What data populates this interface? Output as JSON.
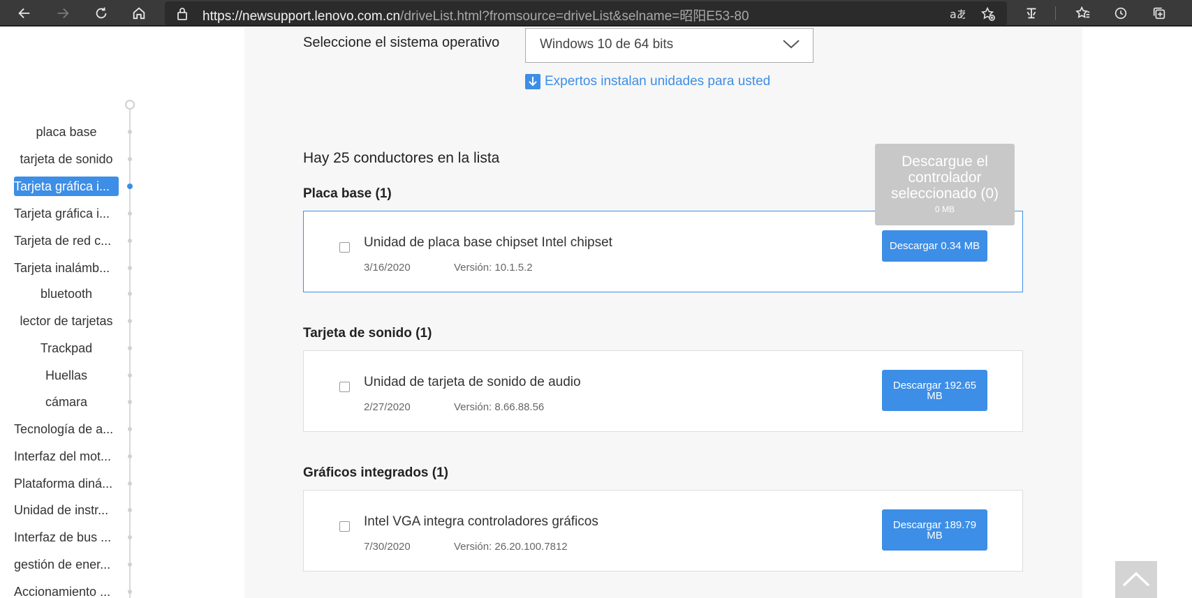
{
  "browser": {
    "url_host": "https://newsupport.lenovo.com.cn",
    "url_rest": "/driveList.html?fromsource=driveList&selname=昭阳E53-80"
  },
  "os": {
    "label": "Seleccione el sistema operativo",
    "selected": "Windows 10 de 64 bits"
  },
  "experts_link": "Expertos instalan unidades para usted",
  "count_text": "Hay 25 conductores en la lista",
  "float_download": {
    "title": "Descargue el controlador seleccionado (0)",
    "size": "0 MB"
  },
  "sidebar": {
    "items": [
      {
        "label": "placa base"
      },
      {
        "label": "tarjeta de sonido"
      },
      {
        "label": "Tarjeta gráfica i..."
      },
      {
        "label": "Tarjeta gráfica i..."
      },
      {
        "label": "Tarjeta de red c..."
      },
      {
        "label": "Tarjeta inalámb..."
      },
      {
        "label": "bluetooth"
      },
      {
        "label": "lector de tarjetas"
      },
      {
        "label": "Trackpad"
      },
      {
        "label": "Huellas"
      },
      {
        "label": "cámara"
      },
      {
        "label": "Tecnología de a..."
      },
      {
        "label": "Interfaz del mot..."
      },
      {
        "label": "Plataforma diná..."
      },
      {
        "label": "Unidad de instr..."
      },
      {
        "label": "Interfaz de bus ..."
      },
      {
        "label": "gestión de ener..."
      },
      {
        "label": "Accionamiento ..."
      }
    ],
    "active_index": 2
  },
  "categories": [
    {
      "title": "Placa base (1)",
      "driver": {
        "name": "Unidad de placa base chipset Intel chipset",
        "date": "3/16/2020",
        "version": "Versión: 10.1.5.2",
        "download": "Descargar 0.34 MB"
      }
    },
    {
      "title": "Tarjeta de sonido (1)",
      "driver": {
        "name": "Unidad de tarjeta de sonido de audio",
        "date": "2/27/2020",
        "version": "Versión: 8.66.88.56",
        "download": "Descargar 192.65 MB"
      }
    },
    {
      "title": "Gráficos integrados (1)",
      "driver": {
        "name": "Intel VGA integra controladores gráficos",
        "date": "7/30/2020",
        "version": "Versión: 26.20.100.7812",
        "download": "Descargar 189.79 MB"
      }
    }
  ],
  "colors": {
    "accent": "#3d8ee6",
    "chrome_bg": "#3a3a3a",
    "content_bg": "#f7f7f7"
  }
}
